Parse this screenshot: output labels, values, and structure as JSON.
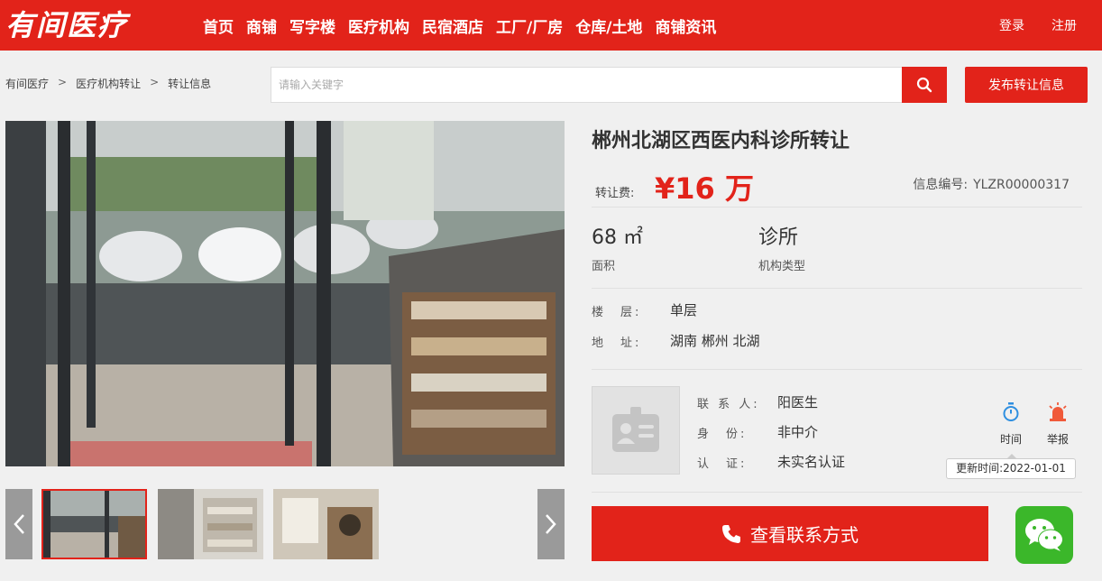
{
  "header": {
    "logo": "有间医疗",
    "nav": [
      "首页",
      "商铺",
      "写字楼",
      "医疗机构",
      "民宿酒店",
      "工厂/厂房",
      "仓库/土地",
      "商铺资讯"
    ],
    "login": "登录",
    "register": "注册",
    "bg_color": "#e2231a"
  },
  "breadcrumb": {
    "items": [
      "有间医疗",
      "医疗机构转让",
      "转让信息"
    ],
    "separator": ">"
  },
  "search": {
    "placeholder": "请输入关键字",
    "icon": "search-icon"
  },
  "publish_button": "发布转让信息",
  "gallery": {
    "thumbnail_count": 3,
    "selected_index": 0,
    "prev_icon": "chevron-left-icon",
    "next_icon": "chevron-right-icon"
  },
  "listing": {
    "title": "郴州北湖区西医内科诊所转让",
    "fee_label": "转让费:",
    "fee_value": "¥16 万",
    "serial_label": "信息编号:",
    "serial_value": "YLZR00000317",
    "area_value": "68 ㎡",
    "area_label": "面积",
    "type_value": "诊所",
    "type_label": "机构类型",
    "floor_label": "楼　层:",
    "floor_value": "单层",
    "address_label": "地　址:",
    "address_value": "湖南 郴州 北湖"
  },
  "contact": {
    "person_label": "联 系 人:",
    "person_value": "阳医生",
    "identity_label": "身　份:",
    "identity_value": "非中介",
    "verify_label": "认　证:",
    "verify_value": "未实名认证",
    "time_action": "时间",
    "report_action": "举报",
    "update_text": "更新时间:2022-01-01",
    "button_label": "查看联系方式",
    "wechat_icon": "wechat-icon"
  }
}
